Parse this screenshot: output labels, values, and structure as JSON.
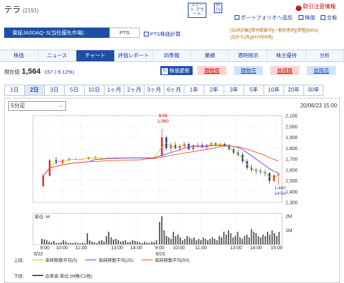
{
  "header": {
    "name": "テラ",
    "code": "(2191)",
    "smart_alert": "スマート アラート",
    "ir_tv": "IR TV",
    "alert_info": "取引注意情報",
    "portfolio": "ポートフォリオへ追加",
    "stock_price": "株価",
    "board": "全板"
  },
  "market": {
    "tab_active": "東証JASDAQ･S(当社優先市場)",
    "tab_pts": "PTS",
    "pts_link": "PTS株価計算",
    "tags": [
      "[SOR対象]",
      "[貸付取扱中]",
      "[一般信用売]",
      "[貸借]",
      "[NISA]",
      "[日計り(売)]",
      "[HYPER売]"
    ]
  },
  "nav": [
    "株価",
    "ニュース",
    "チャート",
    "評価レポート",
    "四季報",
    "業績",
    "適時開示",
    "株主優待",
    "分析"
  ],
  "nav_active": 2,
  "quote": {
    "label": "現在値",
    "price": "1,564",
    "change": "-157 (-9.12%)",
    "refresh": "株価更新",
    "buttons": [
      "現物買",
      "現物売",
      "信用買",
      "信用売"
    ]
  },
  "periods": [
    "1日",
    "2日",
    "3日",
    "5日",
    "10日",
    "1ヶ月",
    "2ヶ月",
    "3ヶ月",
    "6ヶ月",
    "1年",
    "2年",
    "3年",
    "5年",
    "10年",
    "20年",
    "30年"
  ],
  "period_active": 1,
  "interval": "5分足",
  "datetime": "20/06/23 15:00",
  "chart_data": {
    "type": "candlestick",
    "price_axis": {
      "ylim": [
        1300,
        2100
      ],
      "ticks": [
        "2,100",
        "2,000",
        "1,900",
        "1,800",
        "1,700",
        "1,600",
        "1,500",
        "1,400",
        "1,300"
      ]
    },
    "volume_axis": {
      "label": "単位: M",
      "ticks": [
        "2M",
        "1M"
      ],
      "ylim": [
        0,
        2.2
      ]
    },
    "x_ticks": [
      "9:00",
      "10:00",
      "11:00",
      "13:00",
      "14:00",
      "9:00",
      "10:00",
      "11:00",
      "13:00",
      "14:00",
      "15:00"
    ],
    "x_dates": [
      "6/22",
      "6/23"
    ],
    "annotations": [
      {
        "time": "9:05",
        "price": "1,980"
      },
      {
        "time": "14:50",
        "price": "1,460"
      }
    ],
    "series": [
      {
        "name": "単純移動平均(5)",
        "color": "#c8c800"
      },
      {
        "name": "単純移動平均(25)",
        "color": "#8a2be2"
      },
      {
        "name": "単純移動平均(50)",
        "color": "#e8501e"
      }
    ],
    "candles_day1": [
      [
        1450,
        1560,
        1440,
        1545
      ],
      [
        1545,
        1700,
        1540,
        1690
      ],
      [
        1690,
        1720,
        1650,
        1665
      ],
      [
        1665,
        1700,
        1650,
        1690
      ],
      [
        1690,
        1720,
        1680,
        1700
      ],
      [
        1700,
        1710,
        1690,
        1695
      ],
      [
        1695,
        1705,
        1690,
        1700
      ],
      [
        1700,
        1720,
        1695,
        1715
      ],
      [
        1715,
        1725,
        1705,
        1708
      ],
      [
        1708,
        1715,
        1700,
        1710
      ],
      [
        1710,
        1715,
        1705,
        1712
      ],
      [
        1712,
        1718,
        1708,
        1710
      ],
      [
        1710,
        1715,
        1705,
        1712
      ],
      [
        1712,
        1716,
        1708,
        1710
      ],
      [
        1710,
        1714,
        1706,
        1712
      ],
      [
        1712,
        1716,
        1708,
        1710
      ],
      [
        1710,
        1714,
        1706,
        1712
      ],
      [
        1712,
        1716,
        1708,
        1710
      ]
    ],
    "candles_day2": [
      [
        1730,
        1980,
        1720,
        1900
      ],
      [
        1900,
        1920,
        1780,
        1800
      ],
      [
        1800,
        1850,
        1760,
        1830
      ],
      [
        1830,
        1860,
        1790,
        1800
      ],
      [
        1800,
        1840,
        1770,
        1820
      ],
      [
        1820,
        1860,
        1800,
        1840
      ],
      [
        1840,
        1850,
        1780,
        1790
      ],
      [
        1790,
        1830,
        1770,
        1820
      ],
      [
        1820,
        1850,
        1800,
        1830
      ],
      [
        1830,
        1850,
        1800,
        1810
      ],
      [
        1810,
        1840,
        1790,
        1830
      ],
      [
        1830,
        1860,
        1815,
        1845
      ],
      [
        1845,
        1855,
        1820,
        1830
      ],
      [
        1830,
        1850,
        1810,
        1840
      ],
      [
        1840,
        1850,
        1810,
        1820
      ],
      [
        1820,
        1840,
        1780,
        1790
      ],
      [
        1790,
        1810,
        1740,
        1760
      ],
      [
        1760,
        1790,
        1720,
        1740
      ],
      [
        1740,
        1760,
        1660,
        1680
      ],
      [
        1680,
        1700,
        1600,
        1620
      ],
      [
        1620,
        1650,
        1580,
        1600
      ],
      [
        1600,
        1620,
        1560,
        1590
      ],
      [
        1590,
        1610,
        1560,
        1580
      ],
      [
        1580,
        1600,
        1540,
        1570
      ],
      [
        1570,
        1580,
        1470,
        1500
      ],
      [
        1500,
        1560,
        1480,
        1550
      ],
      [
        1550,
        1570,
        1460,
        1564
      ]
    ],
    "volumes_day1": [
      0.4,
      0.35,
      0.3,
      0.2,
      0.15,
      0.25,
      0.1,
      0.12,
      0.15,
      0.3,
      0.2,
      0.1,
      0.12,
      0.1,
      0.15,
      0.1,
      0.08,
      0.12,
      0.1,
      0.8,
      0.3,
      0.2,
      0.15,
      0.1,
      0.25,
      0.3,
      0.2,
      0.6,
      0.9,
      0.5,
      0.35,
      0.4,
      0.3,
      0.2,
      0.25,
      0.3,
      0.15,
      0.2,
      0.3,
      0.25,
      0.2,
      0.15,
      0.1,
      0.2,
      0.15,
      0.1,
      0.2,
      0.15,
      0.3
    ],
    "volumes_day2": [
      1.6,
      2.0,
      1.0,
      0.6,
      0.5,
      0.4,
      0.9,
      0.6,
      0.7,
      0.5,
      0.3,
      0.4,
      0.6,
      0.5,
      0.4,
      0.5,
      0.3,
      0.4,
      0.3,
      0.5,
      0.4,
      0.3,
      0.4,
      0.5,
      0.4,
      0.3,
      0.6,
      0.5,
      0.9,
      0.7,
      1.0,
      0.8,
      0.5,
      0.6,
      0.9,
      0.5,
      0.4,
      0.6,
      0.7,
      0.5,
      1.1,
      0.9,
      0.8,
      0.6,
      0.5,
      0.7,
      0.6,
      0.9,
      0.7,
      1.0,
      0.8,
      0.6,
      0.9
    ]
  },
  "legend": {
    "upper": "上段:",
    "lower": "下段:",
    "lower_text": "出来高 単位:(M株/口/枚)"
  }
}
